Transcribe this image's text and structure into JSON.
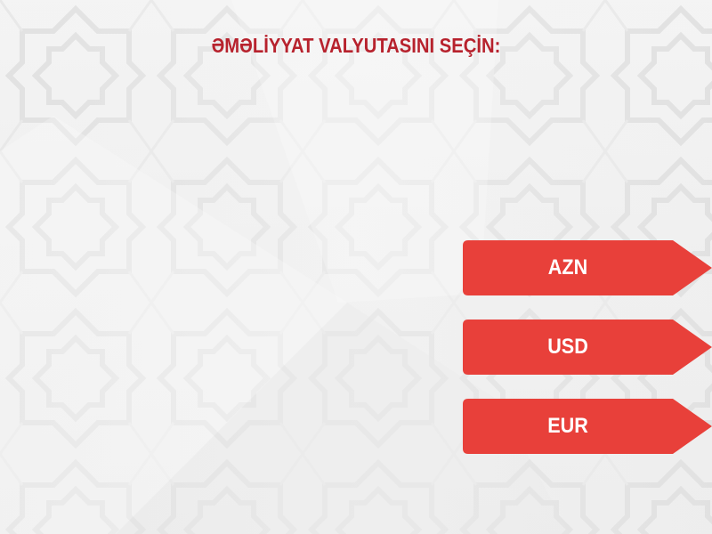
{
  "header": {
    "title": "ƏMƏLİYYAT VALYUTASINI SEÇİN:"
  },
  "currency_buttons": [
    {
      "label": "AZN"
    },
    {
      "label": "USD"
    },
    {
      "label": "EUR"
    }
  ],
  "colors": {
    "title": "#b7222d",
    "button": "#e8403a",
    "button_text": "#ffffff",
    "background": "#f1f1f1",
    "pattern": "#dcdcdc"
  }
}
